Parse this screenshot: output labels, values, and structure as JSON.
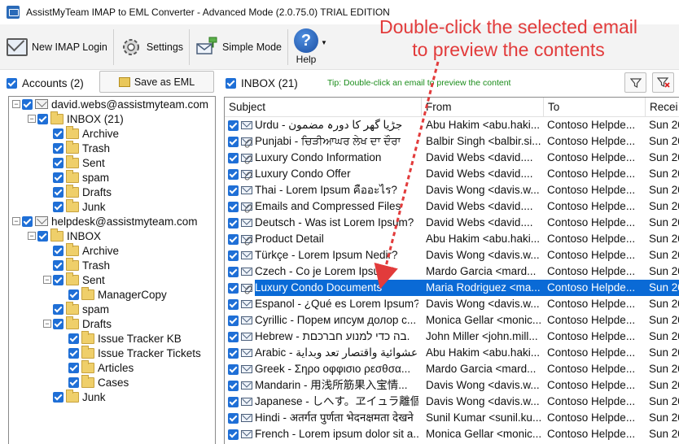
{
  "window": {
    "title": "AssistMyTeam IMAP to EML Converter - Advanced Mode (2.0.75.0) TRIAL EDITION"
  },
  "toolbar": {
    "login_label": "New IMAP Login",
    "settings_label": "Settings",
    "simple_label": "Simple Mode",
    "help_label": "Help"
  },
  "accounts": {
    "label": "Accounts (2)",
    "save_label": "Save as EML"
  },
  "tree": {
    "account1": "david.webs@assistmyteam.com",
    "account1_folders": {
      "inbox": "INBOX (21)",
      "archive": "Archive",
      "trash": "Trash",
      "sent": "Sent",
      "spam": "spam",
      "drafts": "Drafts",
      "junk": "Junk"
    },
    "account2": "helpdesk@assistmyteam.com",
    "account2_folders": {
      "inbox": "INBOX",
      "archive": "Archive",
      "trash": "Trash",
      "sent": "Sent",
      "manager_copy": "ManagerCopy",
      "spam": "spam",
      "drafts": "Drafts",
      "issue_tracker_kb": "Issue Tracker KB",
      "issue_tracker_tickets": "Issue Tracker Tickets",
      "articles": "Articles",
      "cases": "Cases",
      "junk": "Junk"
    }
  },
  "mail": {
    "folder_label": "INBOX (21)",
    "tip": "Tip: Double-click an email to preview the content",
    "columns": [
      "Subject",
      "From",
      "To",
      "Recei"
    ],
    "rows": [
      {
        "subject": "Urdu - جڑیا گھر کا دورہ مضمون",
        "from": "Abu Hakim <abu.haki...",
        "to": "Contoso Helpde...",
        "received": "Sun 20",
        "attach": false
      },
      {
        "subject": "Punjabi - ਚਿੜੀਆਘਰ ਲੇਖ ਦਾ ਦੌਰਾ",
        "from": "Balbir Singh <balbir.si...",
        "to": "Contoso Helpde...",
        "received": "Sun 20",
        "attach": true
      },
      {
        "subject": "Luxury Condo Information",
        "from": "David Webs <david....",
        "to": "Contoso Helpde...",
        "received": "Sun 20",
        "attach": true
      },
      {
        "subject": "Luxury Condo Offer",
        "from": "David Webs <david....",
        "to": "Contoso Helpde...",
        "received": "Sun 20",
        "attach": true
      },
      {
        "subject": "Thai - Lorem Ipsum คืออะไร?",
        "from": "Davis Wong <davis.w...",
        "to": "Contoso Helpde...",
        "received": "Sun 20",
        "attach": false
      },
      {
        "subject": "Emails and Compressed Files",
        "from": "David Webs <david....",
        "to": "Contoso Helpde...",
        "received": "Sun 20",
        "attach": true
      },
      {
        "subject": "Deutsch - Was ist Lorem Ipsum?",
        "from": "David Webs <david....",
        "to": "Contoso Helpde...",
        "received": "Sun 20",
        "attach": false
      },
      {
        "subject": "Product Detail",
        "from": "Abu Hakim <abu.haki...",
        "to": "Contoso Helpde...",
        "received": "Sun 20",
        "attach": true
      },
      {
        "subject": "Türkçe - Lorem Ipsum Nedir?",
        "from": "Davis Wong <davis.w...",
        "to": "Contoso Helpde...",
        "received": "Sun 20",
        "attach": false
      },
      {
        "subject": "Czech - Co je Lorem Ipsum?",
        "from": "Mardo Garcia <mard...",
        "to": "Contoso Helpde...",
        "received": "Sun 20",
        "attach": false
      },
      {
        "subject": "Luxury Condo Documents",
        "from": "Maria Rodriguez <ma...",
        "to": "Contoso Helpde...",
        "received": "Sun 20",
        "attach": true
      },
      {
        "subject": "Espanol - ¿Qué es Lorem Ipsum?",
        "from": "Davis Wong <davis.w...",
        "to": "Contoso Helpde...",
        "received": "Sun 20",
        "attach": false
      },
      {
        "subject": "Cyrillic - Порем ипсум долор с...",
        "from": "Monica Gellar <monic...",
        "to": "Contoso Helpde...",
        "received": "Sun 20",
        "attach": false
      },
      {
        "subject": "Hebrew - בה כדי למנוע חברכםת.",
        "from": "John Miller <john.mill...",
        "to": "Contoso Helpde...",
        "received": "Sun 20",
        "attach": false
      },
      {
        "subject": "Arabic - عشوائية واقتصار تعد وبداية",
        "from": "Abu Hakim <abu.haki...",
        "to": "Contoso Helpde...",
        "received": "Sun 20",
        "attach": false
      },
      {
        "subject": "Greek - Σηρο οφφισιο ρεσθσα...",
        "from": "Mardo Garcia <mard...",
        "to": "Contoso Helpde...",
        "received": "Sun 20",
        "attach": false
      },
      {
        "subject": "Mandarin - 用浅所筋果入宝情...",
        "from": "Davis Wong <davis.w...",
        "to": "Contoso Helpde...",
        "received": "Sun 20",
        "attach": false
      },
      {
        "subject": "Japanese - しへす。ヱイュラ離個...",
        "from": "Davis Wong <davis.w...",
        "to": "Contoso Helpde...",
        "received": "Sun 20",
        "attach": false
      },
      {
        "subject": "Hindi - अतर्गत पुर्णता भेदनक्षमता देखने",
        "from": "Sunil Kumar <sunil.ku...",
        "to": "Contoso Helpde...",
        "received": "Sun 20",
        "attach": false
      },
      {
        "subject": "French - Lorem ipsum dolor sit a...",
        "from": "Monica Gellar <monic...",
        "to": "Contoso Helpde...",
        "received": "Sun 20",
        "attach": false
      }
    ],
    "selected_index": 10
  },
  "annotation": {
    "line1": "Double-click the selected email",
    "line2": "to preview the contents",
    "color": "#e23b3b"
  },
  "colors": {
    "accent": "#1f6fd6",
    "selection": "#0a6ad6",
    "tip": "#1a8c1a"
  }
}
